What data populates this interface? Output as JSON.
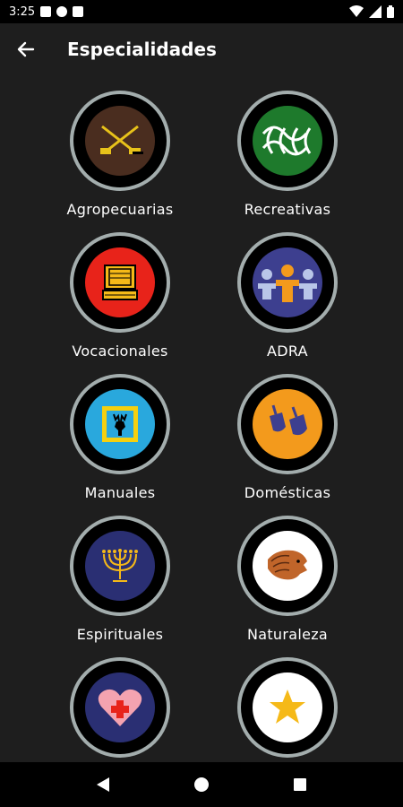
{
  "status_bar": {
    "time": "3:25",
    "left_icons": [
      "notification-a-icon",
      "notification-f-icon",
      "sd-card-icon"
    ],
    "right_icons": [
      "wifi-icon",
      "signal-icon",
      "battery-icon"
    ]
  },
  "app_bar": {
    "title": "Especialidades",
    "back_icon": "arrow-left-icon"
  },
  "categories": [
    {
      "label": "Agropecuarias",
      "color": "#4a2d1f",
      "icon": "crossed-tools-icon"
    },
    {
      "label": "Recreativas",
      "color": "#1e7a2c",
      "icon": "knot-icon"
    },
    {
      "label": "Vocacionales",
      "color": "#e8231a",
      "icon": "computer-icon"
    },
    {
      "label": "ADRA",
      "color": "#3d3f8f",
      "icon": "people-icon"
    },
    {
      "label": "Manuales",
      "color": "#29a8dd",
      "icon": "deer-frame-icon"
    },
    {
      "label": "Domésticas",
      "color": "#f39a1c",
      "icon": "pots-icon"
    },
    {
      "label": "Espirituales",
      "color": "#2a2f73",
      "icon": "menorah-icon"
    },
    {
      "label": "Naturaleza",
      "color": "#ffffff",
      "icon": "lion-icon"
    },
    {
      "label": "",
      "color": "#2a2f73",
      "icon": "heart-cross-icon"
    },
    {
      "label": "",
      "color": "#ffffff",
      "icon": "star-icon"
    }
  ],
  "nav_bar": {
    "buttons": [
      "back-triangle-icon",
      "home-circle-icon",
      "recents-square-icon"
    ]
  },
  "colors": {
    "background": "#1e1e1e",
    "badge_rim": "#a3adad",
    "badge_ring": "#000000"
  }
}
